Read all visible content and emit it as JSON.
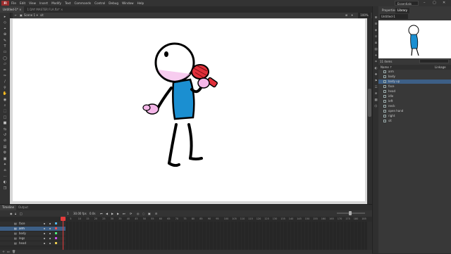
{
  "app": {
    "logo": "Fl"
  },
  "menu": [
    "File",
    "Edit",
    "View",
    "Insert",
    "Modify",
    "Text",
    "Commands",
    "Control",
    "Debug",
    "Window",
    "Help"
  ],
  "workspace": "Essentials",
  "window_controls": [
    "–",
    "▢",
    "✕"
  ],
  "doc_tabs": [
    {
      "label": "Untitled-1* ×",
      "active": true
    },
    {
      "label": "1 DAY MASTER FLA.fla* ×",
      "active": false
    }
  ],
  "scene": {
    "label": "Scene 1",
    "symbol": "sit",
    "zoom": "100%"
  },
  "panel_tabs": {
    "properties": "Properties",
    "library": "Library"
  },
  "library": {
    "doc": "Untitled-1",
    "count": "11 items",
    "header_name": "Name ↑",
    "header_linkage": "Linkage",
    "items": [
      "arm",
      "body",
      "body up",
      "face",
      "head",
      "idle",
      "left",
      "neck",
      "open hand",
      "right",
      "sit"
    ],
    "selected": "body up"
  },
  "timeline": {
    "tabs": [
      "Timeline",
      "Output"
    ],
    "fps": "30.00 fps",
    "time": "0.0s",
    "frame": "1",
    "ruler": [
      "1",
      "5",
      "10",
      "15",
      "20",
      "25",
      "30",
      "35",
      "40",
      "45",
      "50",
      "55",
      "60",
      "65",
      "70",
      "75",
      "80",
      "85",
      "90",
      "95",
      "100",
      "105",
      "110",
      "115",
      "120",
      "125",
      "130",
      "135",
      "140",
      "145",
      "150",
      "155",
      "160",
      "165",
      "170",
      "175",
      "180",
      "185"
    ],
    "layers": [
      {
        "name": "face",
        "selected": false,
        "color": "#4fb3e8"
      },
      {
        "name": "arm",
        "selected": true,
        "color": "#e84f4f"
      },
      {
        "name": "body",
        "selected": false,
        "color": "#4fe87a"
      },
      {
        "name": "legs",
        "selected": false,
        "color": "#c84fe8"
      },
      {
        "name": "head",
        "selected": false,
        "color": "#e8c84f"
      }
    ]
  },
  "tools": [
    "▸",
    "◇",
    "⌖",
    "⊕",
    "✎",
    "T",
    "▭",
    "◯",
    "▱",
    "✏",
    "✑",
    "∕",
    "⚲",
    "✋",
    "◉",
    "⌕",
    "⬚",
    "□",
    "■",
    "⇆",
    "↺",
    "⊘",
    "▤",
    "⚙",
    "▣",
    "✦",
    "⌂",
    "⋯",
    "◐",
    "❒"
  ],
  "strip_icons": [
    "⊞",
    "⊟",
    "◈",
    "⊙",
    "≣",
    "▤",
    "✦",
    "⌗",
    "◐",
    "❖",
    "⚑",
    "☰",
    "⊛",
    "▦",
    "⌬"
  ],
  "colors": {
    "shirt": "#1b8fd1",
    "mic": "#e0303a",
    "hand": "#f4b6e8",
    "playhead": "#e23b3b",
    "selection": "#3d5f86"
  }
}
